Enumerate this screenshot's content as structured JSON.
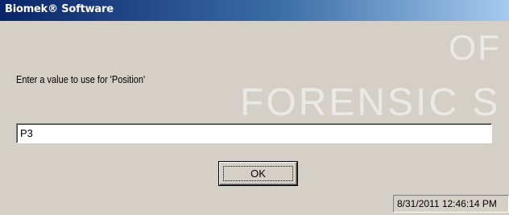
{
  "window": {
    "title": "Biomek® Software"
  },
  "watermark": {
    "line1": "OF",
    "line2": "FORENSIC S"
  },
  "dialog": {
    "prompt": "Enter a value to use for 'Position'",
    "input_value": "P3",
    "ok_label": "OK"
  },
  "status": {
    "timestamp": "8/31/2011 12:46:14 PM"
  },
  "colors": {
    "titlebar_start": "#0a246a",
    "titlebar_end": "#a6caf0",
    "dialog_background": "#d4d0c8"
  }
}
